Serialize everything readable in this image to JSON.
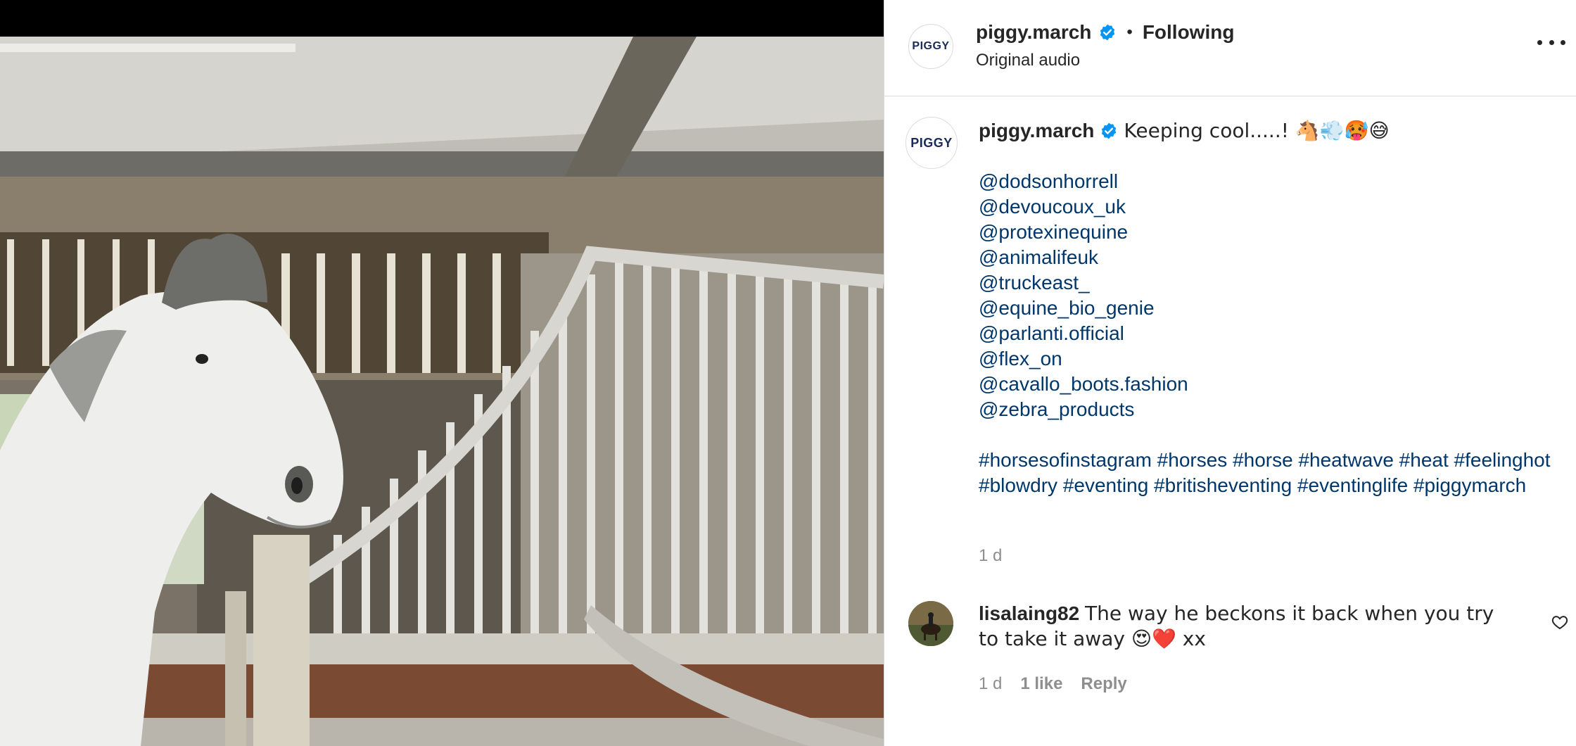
{
  "header": {
    "username": "piggy.march",
    "separator": "•",
    "follow_status": "Following",
    "audio": "Original audio",
    "avatar_logo": "PIGGY"
  },
  "caption": {
    "username": "piggy.march",
    "text": "Keeping cool.....! 🐴💨🥵😅",
    "mentions": [
      "@dodsonhorrell",
      "@devoucoux_uk",
      "@protexinequine",
      "@animalifeuk",
      "@truckeast_",
      "@equine_bio_genie",
      "@parlanti.official",
      "@flex_on",
      "@cavallo_boots.fashion",
      "@zebra_products"
    ],
    "hashtags": "#horsesofinstagram #horses #horse #heatwave #heat #feelinghot #blowdry #eventing #britisheventing #eventinglife #piggymarch",
    "time": "1 d"
  },
  "comment": {
    "username": "lisalaing82",
    "text": "The way he beckons it back when you try to take it away 😍❤️ xx",
    "time": "1 d",
    "likes": "1 like",
    "reply": "Reply"
  },
  "icons": {
    "verified": "verified-badge-icon",
    "more": "more-options-icon",
    "like": "heart-icon"
  },
  "colors": {
    "link": "#00376b",
    "verified": "#0095f6",
    "muted": "#8e8e8e",
    "text": "#262626"
  }
}
